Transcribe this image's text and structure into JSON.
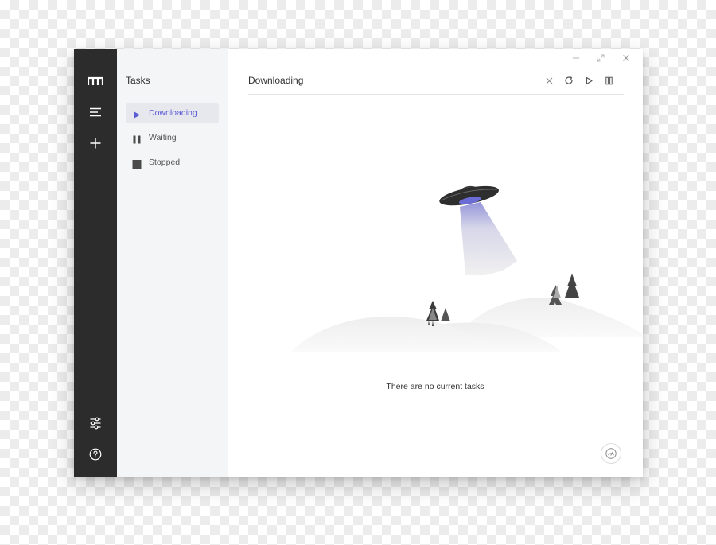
{
  "app": {
    "logo_icon": "motrix-logo-icon"
  },
  "rail": {
    "menu_icon": "menu-lines-icon",
    "add_icon": "plus-icon",
    "preferences_icon": "sliders-icon",
    "help_icon": "question-circle-icon"
  },
  "tasks_panel": {
    "title": "Tasks",
    "items": [
      {
        "label": "Downloading",
        "icon": "play-icon",
        "active": true
      },
      {
        "label": "Waiting",
        "icon": "pause-icon",
        "active": false
      },
      {
        "label": "Stopped",
        "icon": "stop-icon",
        "active": false
      }
    ]
  },
  "window_controls": {
    "minimize_icon": "minimize-icon",
    "maximize_icon": "maximize-icon",
    "close_icon": "close-icon"
  },
  "main": {
    "title": "Downloading",
    "toolbar": {
      "delete_icon": "close-icon",
      "refresh_icon": "refresh-icon",
      "resume_all_icon": "play-outline-icon",
      "pause_all_icon": "pause-icon"
    },
    "empty_message": "There are no current tasks",
    "speed_icon": "speedometer-icon"
  },
  "colors": {
    "rail_background": "#2c2c2c",
    "panel_background": "#f4f5f7",
    "accent": "#5b5bd6",
    "active_item_background": "#e6e8ee"
  }
}
